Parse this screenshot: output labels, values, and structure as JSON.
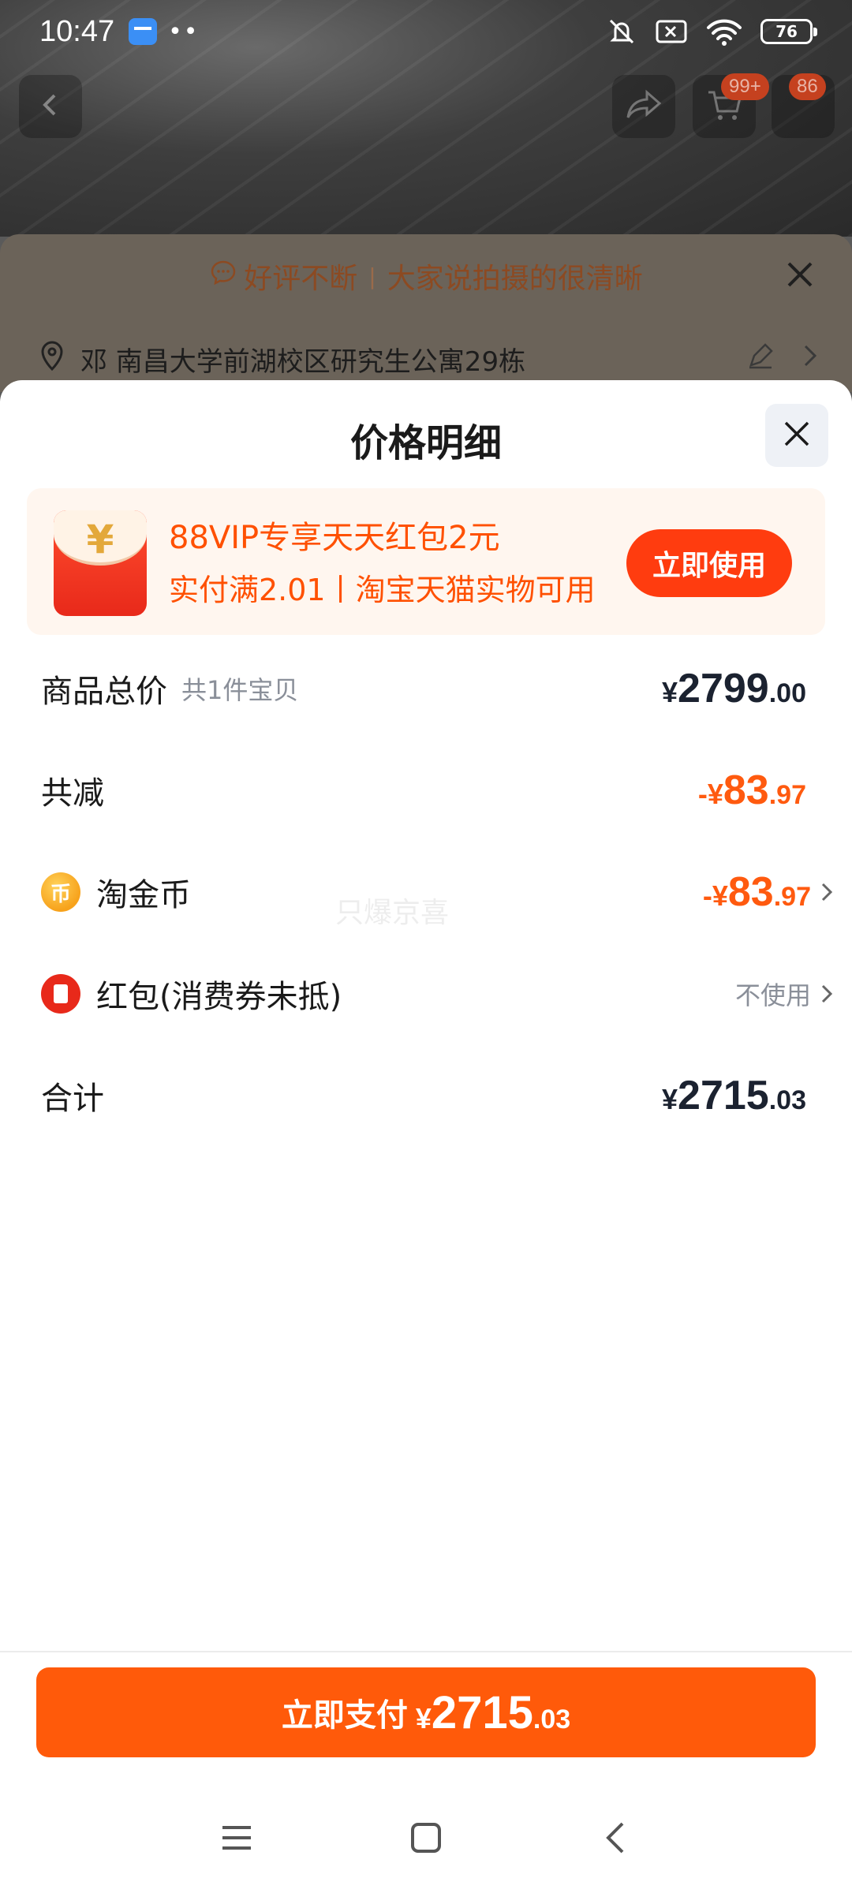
{
  "status_bar": {
    "time": "10:47",
    "dots": "••",
    "battery": "76"
  },
  "top_nav": {
    "cart_badge": "99+",
    "message_badge": "86"
  },
  "background_page": {
    "promo_left": "好评不断",
    "promo_right": "大家说拍摄的很清晰",
    "address": "邓 南昌大学前湖校区研究生公寓29栋"
  },
  "sheet": {
    "title": "价格明细",
    "vip_banner": {
      "line1": "88VIP专享天天红包2元",
      "line2": "实付满2.01丨淘宝天猫实物可用",
      "button": "立即使用",
      "envelope_symbol": "¥"
    },
    "rows": {
      "total_goods": {
        "label": "商品总价",
        "sub": "共1件宝贝",
        "currency": "¥",
        "int": "2799",
        "dec": ".00"
      },
      "total_reduction": {
        "label": "共减",
        "currency": "-¥",
        "int": "83",
        "dec": ".97"
      },
      "taojinbi": {
        "label": "淘金币",
        "icon_text": "币",
        "currency": "-¥",
        "int": "83",
        "dec": ".97"
      },
      "red_packet": {
        "label": "红包(消费券未抵)",
        "value": "不使用"
      },
      "sum": {
        "label": "合计",
        "currency": "¥",
        "int": "2715",
        "dec": ".03"
      }
    },
    "watermark": "只爆京喜",
    "pay_button": {
      "label": "立即支付",
      "currency": "¥",
      "int": "2715",
      "dec": ".03"
    }
  },
  "colors": {
    "accent_orange": "#ff5a0a",
    "price_orange": "#ff5a0f",
    "dark_text": "#1b2230",
    "muted_text": "#8a8f99"
  },
  "icons": [
    "back-icon",
    "share-icon",
    "cart-icon",
    "more-icon",
    "close-icon",
    "location-pin-icon",
    "edit-icon",
    "chevron-right-icon",
    "coin-icon",
    "red-packet-icon",
    "menu-icon",
    "home-icon",
    "back-nav-icon"
  ]
}
